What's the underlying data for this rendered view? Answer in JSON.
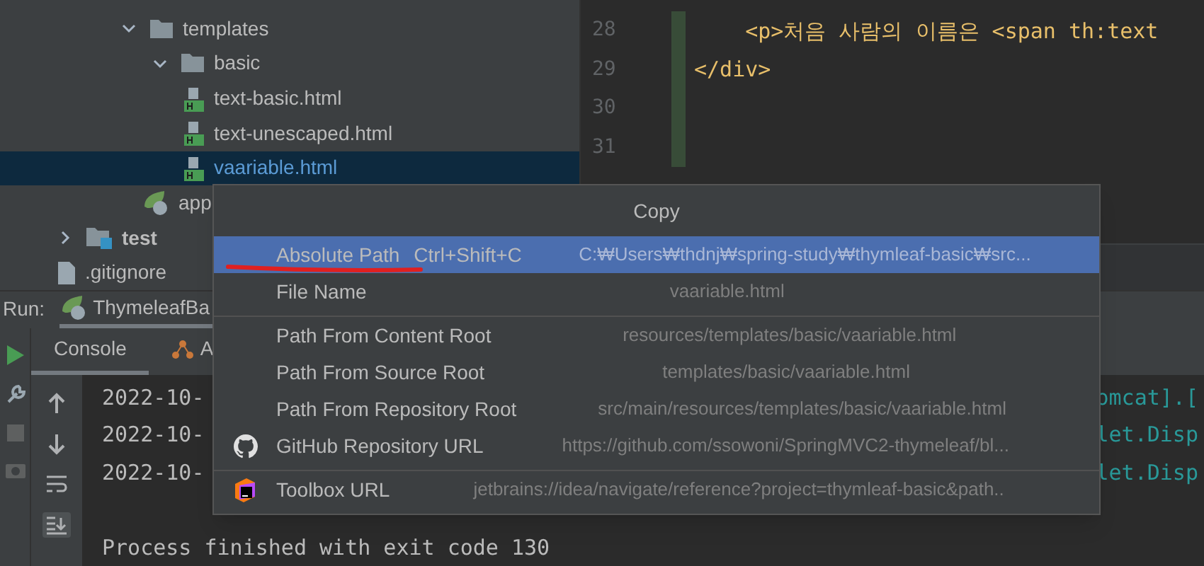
{
  "project_tree": [
    {
      "label": "templates",
      "kind": "folder",
      "expanded": true,
      "selected": false,
      "children": [
        {
          "label": "basic",
          "kind": "folder",
          "expanded": true,
          "selected": false,
          "children": [
            {
              "label": "text-basic.html",
              "kind": "html",
              "selected": false
            },
            {
              "label": "text-unescaped.html",
              "kind": "html",
              "selected": false
            },
            {
              "label": "vaariable.html",
              "kind": "html",
              "selected": true
            }
          ]
        }
      ]
    },
    {
      "label": "app",
      "kind": "spring-class",
      "selected": false
    },
    {
      "label": "test",
      "kind": "test-folder",
      "expanded": false,
      "selected": false
    },
    {
      "label": ".gitignore",
      "kind": "file",
      "selected": false
    }
  ],
  "editor": {
    "lines": [
      {
        "number": "28",
        "code": "    <p>처음 사람의 이름은 <span th:text"
      },
      {
        "number": "29",
        "code": "</div>"
      },
      {
        "number": "30"
      },
      {
        "number": "31"
      }
    ]
  },
  "run_panel": {
    "label": "Run:",
    "config": "ThymeleafBa",
    "tabs": [
      {
        "label": "Console",
        "selected": true
      },
      {
        "label": "A",
        "selected": false
      }
    ],
    "console_lines": [
      {
        "kind": "log",
        "text": "2022-10-",
        "tail": "omcat].["
      },
      {
        "kind": "log",
        "text": "2022-10-",
        "tail": "let.Disp"
      },
      {
        "kind": "log",
        "text": "2022-10-",
        "tail": "let.Disp"
      },
      {
        "kind": "blank"
      },
      {
        "kind": "log",
        "text": "Process finished with exit code 130"
      }
    ]
  },
  "copy_popup": {
    "title": "Copy",
    "items": [
      {
        "label": "Absolute Path",
        "shortcut": "Ctrl+Shift+C",
        "value": "C:₩Users₩thdnj₩spring-study₩thymleaf-basic₩src...",
        "selected": true,
        "kind": "plain",
        "separator_after": false,
        "underlined": true
      },
      {
        "label": "File Name",
        "value": "vaariable.html",
        "selected": false,
        "kind": "plain",
        "separator_after": true,
        "underlined": false
      },
      {
        "label": "Path From Content Root",
        "value": "resources/templates/basic/vaariable.html",
        "selected": false,
        "kind": "plain",
        "separator_after": false,
        "underlined": false
      },
      {
        "label": "Path From Source Root",
        "value": "templates/basic/vaariable.html",
        "selected": false,
        "kind": "plain",
        "separator_after": false,
        "underlined": false
      },
      {
        "label": "Path From Repository Root",
        "value": "src/main/resources/templates/basic/vaariable.html",
        "selected": false,
        "kind": "plain",
        "separator_after": false,
        "underlined": false
      },
      {
        "label": "GitHub Repository URL",
        "value": "https://github.com/ssowoni/SpringMVC2-thymeleaf/bl...",
        "selected": false,
        "kind": "github",
        "separator_after": true,
        "underlined": false
      },
      {
        "label": "Toolbox URL",
        "value": "jetbrains://idea/navigate/reference?project=thymleaf-basic&path..",
        "selected": false,
        "kind": "toolbox",
        "separator_after": false,
        "underlined": false
      }
    ]
  }
}
